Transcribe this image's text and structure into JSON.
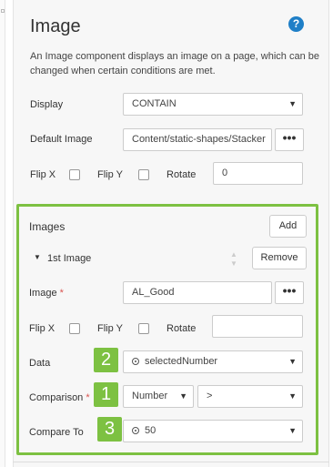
{
  "panel": {
    "title": "Image",
    "help_icon": "question-circle-icon",
    "description": "An Image component displays an image on a page, which can be changed when certain conditions are met.",
    "display": {
      "label": "Display",
      "value": "CONTAIN"
    },
    "default_image": {
      "label": "Default Image",
      "value": "Content/static-shapes/Stacker",
      "browse_label": "•••"
    },
    "flip_x": {
      "label": "Flip X",
      "checked": false
    },
    "flip_y": {
      "label": "Flip Y",
      "checked": false
    },
    "rotate": {
      "label": "Rotate",
      "value": "0"
    }
  },
  "images_section": {
    "title": "Images",
    "add_label": "Add",
    "item": {
      "toggle_icon": "triangle-down-icon",
      "name": "1st Image",
      "remove_label": "Remove",
      "image": {
        "label": "Image",
        "required_mark": "*",
        "value": "AL_Good",
        "browse_label": "•••"
      },
      "flip_x": {
        "label": "Flip X",
        "checked": false
      },
      "flip_y": {
        "label": "Flip Y",
        "checked": false
      },
      "rotate": {
        "label": "Rotate",
        "value": ""
      },
      "data": {
        "label": "Data",
        "value": "selectedNumber",
        "badge": "2"
      },
      "comparison": {
        "label": "Comparison",
        "required_mark": "*",
        "type_value": "Number",
        "operator_value": ">",
        "badge": "1"
      },
      "compare_to": {
        "label": "Compare To",
        "value": "50",
        "badge": "3"
      }
    }
  },
  "colors": {
    "accent_green": "#7dc142",
    "help_blue": "#1f7fc7",
    "required_red": "#d9534f"
  }
}
